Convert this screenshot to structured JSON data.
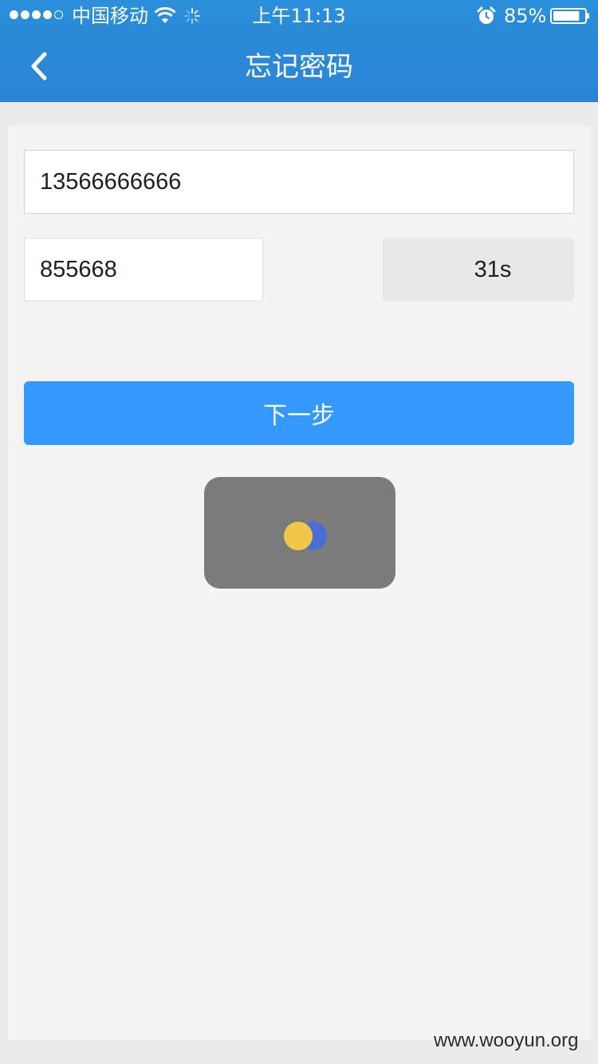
{
  "status_bar": {
    "carrier": "中国移动",
    "time": "上午11:13",
    "battery_percent": "85%",
    "battery_level": 0.85,
    "signal_bars_filled": 4,
    "signal_bars_total": 5
  },
  "header": {
    "title": "忘记密码",
    "back_icon": "chevron-left-icon"
  },
  "form": {
    "phone_value": "13566666666",
    "code_value": "855668",
    "countdown_label": "31s",
    "next_button_label": "下一步"
  },
  "loading": {
    "icon": "loading-spinner-icon"
  },
  "watermark": "www.wooyun.org",
  "colors": {
    "header": "#2b8ad8",
    "primary_button": "#3598fc",
    "toast": "#7b7b7b",
    "spinner_yellow": "#f2c648",
    "spinner_blue": "#4a6ed6"
  }
}
